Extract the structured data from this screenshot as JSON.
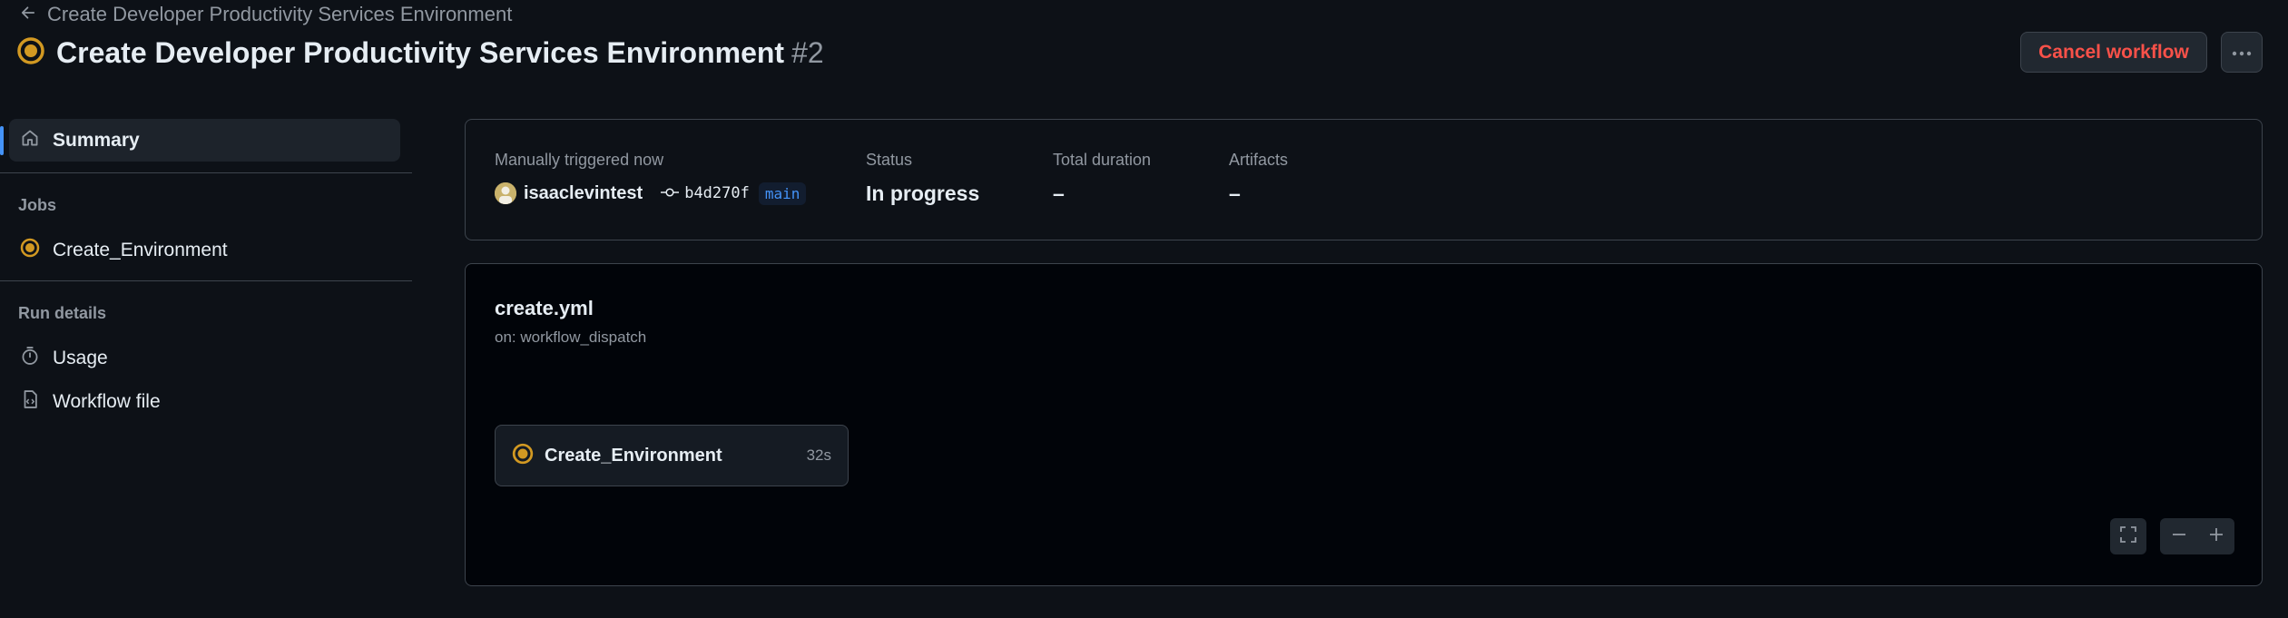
{
  "header": {
    "back_label": "Create Developer Productivity Services Environment",
    "title": "Create Developer Productivity Services Environment",
    "run_number": "#2",
    "cancel_label": "Cancel workflow",
    "more_icon": "kebab-horizontal-icon",
    "status": "in-progress"
  },
  "sidebar": {
    "summary_label": "Summary",
    "jobs_heading": "Jobs",
    "job_label": "Create_Environment",
    "run_details_heading": "Run details",
    "usage_label": "Usage",
    "workflow_file_label": "Workflow file"
  },
  "summary": {
    "trigger_label": "Manually triggered now",
    "actor": "isaaclevintest",
    "commit": "b4d270f",
    "branch": "main",
    "status_label": "Status",
    "status_value": "In progress",
    "duration_label": "Total duration",
    "duration_value": "–",
    "artifacts_label": "Artifacts",
    "artifacts_value": "–"
  },
  "graph": {
    "workflow_file": "create.yml",
    "trigger": "on: workflow_dispatch",
    "job_name": "Create_Environment",
    "job_time": "32s"
  },
  "colors": {
    "background": "#0d1117",
    "accent_blue": "#4493f8",
    "in_progress_yellow": "#d29922",
    "danger_red": "#f85149"
  }
}
